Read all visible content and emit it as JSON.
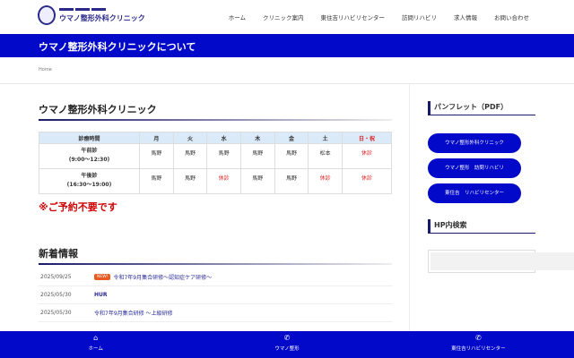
{
  "header": {
    "logo_name": "ウマノ整形外科クリニック",
    "nav": [
      "ホーム",
      "クリニック案内",
      "東住吉リハビリセンター",
      "訪問リハビリ",
      "求人情報",
      "お問い合わせ"
    ]
  },
  "banner": {
    "title": "ウマノ整形外科クリニックについて"
  },
  "breadcrumb": "Home",
  "main": {
    "title": "ウマノ整形外科クリニック",
    "schedule": {
      "headers": [
        "診療時間",
        "月",
        "火",
        "水",
        "木",
        "金",
        "土",
        "日・祝"
      ],
      "rows": [
        {
          "label": "午前診",
          "time": "(9:00〜12:30)",
          "cells": [
            "馬野",
            "馬野",
            "馬野",
            "馬野",
            "馬野",
            "松本",
            "休診"
          ]
        },
        {
          "label": "午後診",
          "time": "(16:30〜19:00)",
          "cells": [
            "馬野",
            "馬野",
            "休診",
            "馬野",
            "馬野",
            "休診",
            "休診"
          ]
        }
      ]
    },
    "note": "※ご予約不要です",
    "news_title": "新着情報",
    "news": [
      {
        "date": "2025/09/25",
        "badge": "NEW!",
        "title": "令和7年9月集合研修〜認知症ケア研修〜"
      },
      {
        "date": "2025/05/30",
        "title": "HUR"
      },
      {
        "date": "2025/05/30",
        "title": "令和7年9月集合研修 〜上級研修"
      }
    ]
  },
  "sidebar": {
    "pamphlet_title": "パンフレット（PDF）",
    "pamphlets": [
      "ウマノ整形外科クリニック",
      "ウマノ整形　訪問リハビリ",
      "東住吉　リハビリセンター"
    ],
    "search_title": "HP内検索"
  },
  "bottom": [
    {
      "label": "ホーム",
      "icon": "home"
    },
    {
      "label": "ウマノ整形",
      "icon": "phone"
    },
    {
      "label": "東住吉リハビリセンター",
      "icon": "phone"
    }
  ]
}
